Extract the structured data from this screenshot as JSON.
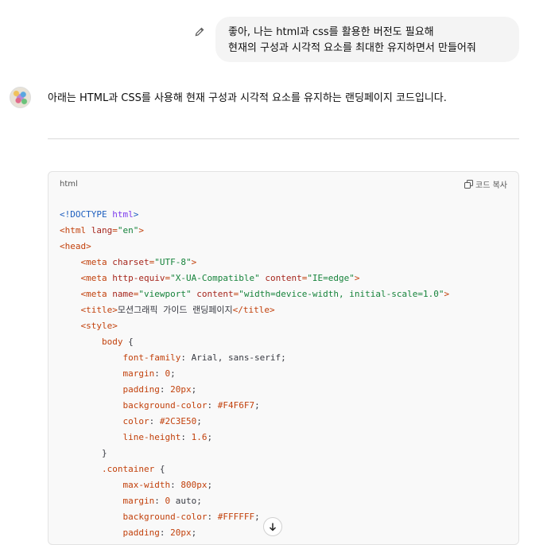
{
  "user_message": {
    "lines": [
      "좋아, 나는 html과 css를 활용한 버전도 필요해",
      "현재의 구성과 시각적 요소를 최대한 유지하면서 만들어줘"
    ]
  },
  "assistant_message": {
    "text": "아래는 HTML과 CSS를 사용해 현재 구성과 시각적 요소를 유지하는 랜딩페이지 코드입니다."
  },
  "code_block": {
    "language": "html",
    "copy_label": "코드 복사",
    "lines": [
      [
        [
          "doc",
          "<!DOCTYPE "
        ],
        [
          "kw",
          "html"
        ],
        [
          "doc",
          ">"
        ]
      ],
      [
        [
          "tag",
          "<html "
        ],
        [
          "attr",
          "lang"
        ],
        [
          "tag",
          "="
        ],
        [
          "val",
          "\"en\""
        ],
        [
          "tag",
          ">"
        ]
      ],
      [
        [
          "tag",
          "<head>"
        ]
      ],
      [
        [
          "text",
          "    "
        ],
        [
          "tag",
          "<meta "
        ],
        [
          "attr",
          "charset"
        ],
        [
          "tag",
          "="
        ],
        [
          "val",
          "\"UTF-8\""
        ],
        [
          "tag",
          ">"
        ]
      ],
      [
        [
          "text",
          "    "
        ],
        [
          "tag",
          "<meta "
        ],
        [
          "attr",
          "http-equiv"
        ],
        [
          "tag",
          "="
        ],
        [
          "val",
          "\"X-UA-Compatible\""
        ],
        [
          "text",
          " "
        ],
        [
          "attr",
          "content"
        ],
        [
          "tag",
          "="
        ],
        [
          "val",
          "\"IE=edge\""
        ],
        [
          "tag",
          ">"
        ]
      ],
      [
        [
          "text",
          "    "
        ],
        [
          "tag",
          "<meta "
        ],
        [
          "attr",
          "name"
        ],
        [
          "tag",
          "="
        ],
        [
          "val",
          "\"viewport\""
        ],
        [
          "text",
          " "
        ],
        [
          "attr",
          "content"
        ],
        [
          "tag",
          "="
        ],
        [
          "val",
          "\"width=device-width, initial-scale=1.0\""
        ],
        [
          "tag",
          ">"
        ]
      ],
      [
        [
          "text",
          "    "
        ],
        [
          "tag",
          "<title>"
        ],
        [
          "text",
          "모션그래픽 가이드 랜딩페이지"
        ],
        [
          "tag",
          "</title>"
        ]
      ],
      [
        [
          "text",
          "    "
        ],
        [
          "tag",
          "<style>"
        ]
      ],
      [
        [
          "text",
          "        "
        ],
        [
          "sel",
          "body"
        ],
        [
          "text",
          " {"
        ]
      ],
      [
        [
          "text",
          "            "
        ],
        [
          "prop",
          "font-family"
        ],
        [
          "text",
          ": Arial, sans-serif;"
        ]
      ],
      [
        [
          "text",
          "            "
        ],
        [
          "prop",
          "margin"
        ],
        [
          "text",
          ": "
        ],
        [
          "num",
          "0"
        ],
        [
          "text",
          ";"
        ]
      ],
      [
        [
          "text",
          "            "
        ],
        [
          "prop",
          "padding"
        ],
        [
          "text",
          ": "
        ],
        [
          "num",
          "20px"
        ],
        [
          "text",
          ";"
        ]
      ],
      [
        [
          "text",
          "            "
        ],
        [
          "prop",
          "background-color"
        ],
        [
          "text",
          ": "
        ],
        [
          "num",
          "#F4F6F7"
        ],
        [
          "text",
          ";"
        ]
      ],
      [
        [
          "text",
          "            "
        ],
        [
          "prop",
          "color"
        ],
        [
          "text",
          ": "
        ],
        [
          "num",
          "#2C3E50"
        ],
        [
          "text",
          ";"
        ]
      ],
      [
        [
          "text",
          "            "
        ],
        [
          "prop",
          "line-height"
        ],
        [
          "text",
          ": "
        ],
        [
          "num",
          "1.6"
        ],
        [
          "text",
          ";"
        ]
      ],
      [
        [
          "text",
          "        }"
        ]
      ],
      [
        [
          "text",
          "        "
        ],
        [
          "sel",
          ".container"
        ],
        [
          "text",
          " {"
        ]
      ],
      [
        [
          "text",
          "            "
        ],
        [
          "prop",
          "max-width"
        ],
        [
          "text",
          ": "
        ],
        [
          "num",
          "800px"
        ],
        [
          "text",
          ";"
        ]
      ],
      [
        [
          "text",
          "            "
        ],
        [
          "prop",
          "margin"
        ],
        [
          "text",
          ": "
        ],
        [
          "num",
          "0"
        ],
        [
          "text",
          " auto;"
        ]
      ],
      [
        [
          "text",
          "            "
        ],
        [
          "prop",
          "background-color"
        ],
        [
          "text",
          ": "
        ],
        [
          "num",
          "#FFFFFF"
        ],
        [
          "text",
          ";"
        ]
      ],
      [
        [
          "text",
          "            "
        ],
        [
          "prop",
          "padding"
        ],
        [
          "text",
          ": "
        ],
        [
          "num",
          "20px"
        ],
        [
          "text",
          ";"
        ]
      ]
    ]
  },
  "icons": {
    "edit": "pencil-icon",
    "copy": "copy-icon",
    "scroll": "arrow-down-icon"
  }
}
